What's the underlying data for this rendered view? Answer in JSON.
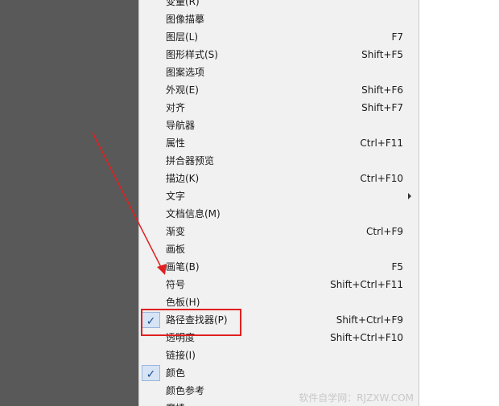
{
  "menu": {
    "items": [
      {
        "label": "变量(R)",
        "shortcut": "",
        "checked": false,
        "submenu": false
      },
      {
        "label": "图像描摹",
        "shortcut": "",
        "checked": false,
        "submenu": false
      },
      {
        "label": "图层(L)",
        "shortcut": "F7",
        "checked": false,
        "submenu": false
      },
      {
        "label": "图形样式(S)",
        "shortcut": "Shift+F5",
        "checked": false,
        "submenu": false
      },
      {
        "label": "图案选项",
        "shortcut": "",
        "checked": false,
        "submenu": false
      },
      {
        "label": "外观(E)",
        "shortcut": "Shift+F6",
        "checked": false,
        "submenu": false
      },
      {
        "label": "对齐",
        "shortcut": "Shift+F7",
        "checked": false,
        "submenu": false
      },
      {
        "label": "导航器",
        "shortcut": "",
        "checked": false,
        "submenu": false
      },
      {
        "label": "属性",
        "shortcut": "Ctrl+F11",
        "checked": false,
        "submenu": false
      },
      {
        "label": "拼合器预览",
        "shortcut": "",
        "checked": false,
        "submenu": false
      },
      {
        "label": "描边(K)",
        "shortcut": "Ctrl+F10",
        "checked": false,
        "submenu": false
      },
      {
        "label": "文字",
        "shortcut": "",
        "checked": false,
        "submenu": true
      },
      {
        "label": "文档信息(M)",
        "shortcut": "",
        "checked": false,
        "submenu": false
      },
      {
        "label": "渐变",
        "shortcut": "Ctrl+F9",
        "checked": false,
        "submenu": false
      },
      {
        "label": "画板",
        "shortcut": "",
        "checked": false,
        "submenu": false
      },
      {
        "label": "画笔(B)",
        "shortcut": "F5",
        "checked": false,
        "submenu": false
      },
      {
        "label": "符号",
        "shortcut": "Shift+Ctrl+F11",
        "checked": false,
        "submenu": false
      },
      {
        "label": "色板(H)",
        "shortcut": "",
        "checked": false,
        "submenu": false
      },
      {
        "label": "路径查找器(P)",
        "shortcut": "Shift+Ctrl+F9",
        "checked": true,
        "submenu": false
      },
      {
        "label": "透明度",
        "shortcut": "Shift+Ctrl+F10",
        "checked": false,
        "submenu": false
      },
      {
        "label": "链接(I)",
        "shortcut": "",
        "checked": false,
        "submenu": false
      },
      {
        "label": "颜色",
        "shortcut": "",
        "checked": true,
        "submenu": false
      },
      {
        "label": "颜色参考",
        "shortcut": "",
        "checked": false,
        "submenu": false
      },
      {
        "label": "魔棒",
        "shortcut": "",
        "checked": false,
        "submenu": false
      }
    ],
    "check_glyph": "✓"
  },
  "watermark": "软件自学网：RJZXW.COM",
  "colors": {
    "annotation": "#e02020",
    "check_bg": "#d6e4f5",
    "menu_bg": "#f1f1f1",
    "backdrop": "#595959"
  }
}
